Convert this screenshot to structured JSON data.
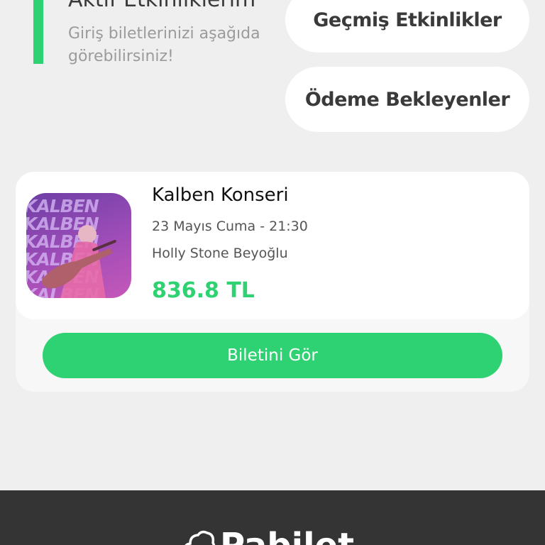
{
  "header": {
    "title": "Aktif Etkinliklerim",
    "subtitle": "Giriş biletlerinizi aşağıda görebilirsiniz!"
  },
  "filters": {
    "past_label": "Geçmiş Etkinlikler",
    "pending_label": "Ödeme Bekleyenler"
  },
  "ticket": {
    "poster_text": "KALBEN KALBEN KALBEN KALBEN KALBEN",
    "title": "Kalben Konseri",
    "date": "23 Mayıs Cuma - 21:30",
    "venue": "Holly Stone Beyoğlu",
    "price": "836.8 TL",
    "button_label": "Biletini Gör"
  },
  "footer": {
    "logo_text": "Pabilet"
  },
  "colors": {
    "accent": "#2fd272",
    "background": "#efefef",
    "footer": "#333433"
  },
  "icons": {
    "logo": "cloud-logo-icon"
  }
}
